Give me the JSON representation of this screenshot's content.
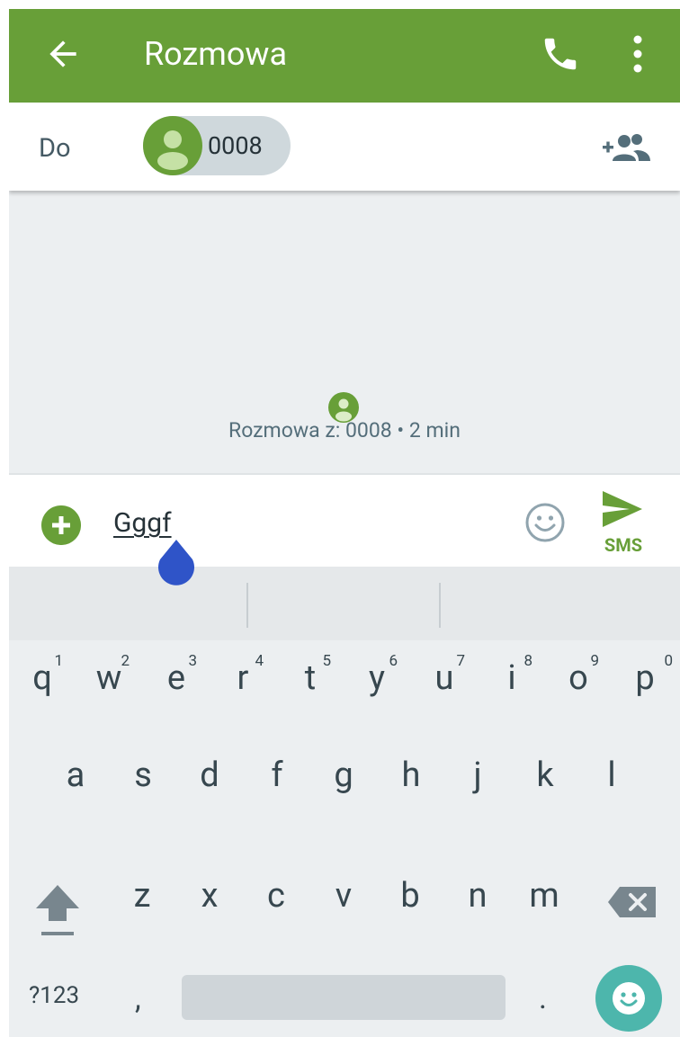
{
  "appbar": {
    "title": "Rozmowa",
    "color": "#689f38"
  },
  "recipient": {
    "to_label": "Do",
    "chip_number": "0008"
  },
  "conversation": {
    "info": "Rozmowa z: 0008 • 2 min"
  },
  "compose": {
    "text": "Gggf",
    "send_label": "SMS"
  },
  "keyboard": {
    "row1": [
      {
        "letter": "q",
        "hint": "1"
      },
      {
        "letter": "w",
        "hint": "2"
      },
      {
        "letter": "e",
        "hint": "3"
      },
      {
        "letter": "r",
        "hint": "4"
      },
      {
        "letter": "t",
        "hint": "5"
      },
      {
        "letter": "y",
        "hint": "6"
      },
      {
        "letter": "u",
        "hint": "7"
      },
      {
        "letter": "i",
        "hint": "8"
      },
      {
        "letter": "o",
        "hint": "9"
      },
      {
        "letter": "p",
        "hint": "0"
      }
    ],
    "row2": [
      "a",
      "s",
      "d",
      "f",
      "g",
      "h",
      "j",
      "k",
      "l"
    ],
    "row3": [
      "z",
      "x",
      "c",
      "v",
      "b",
      "n",
      "m"
    ],
    "symbols_label": "?123",
    "comma": ",",
    "period": "."
  }
}
